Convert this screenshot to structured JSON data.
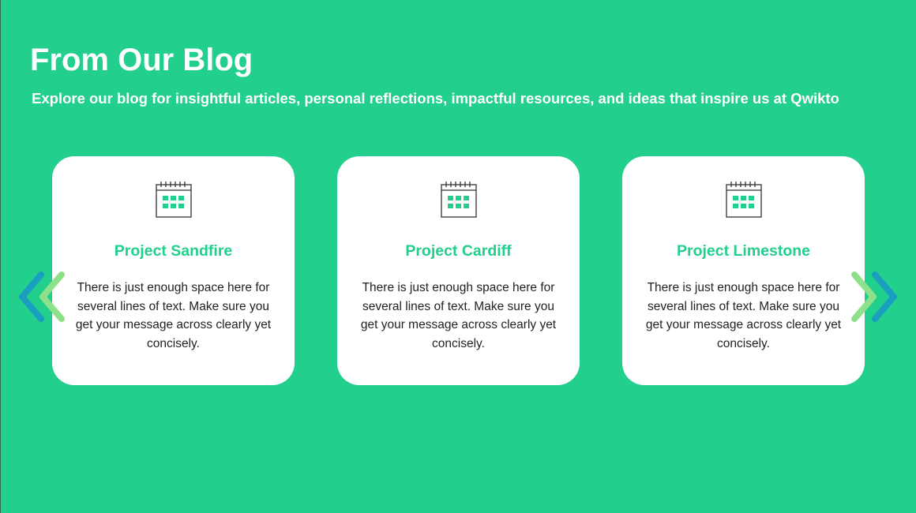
{
  "header": {
    "title": "From Our Blog",
    "subtitle": "Explore our blog for insightful articles, personal reflections, impactful resources, and ideas that inspire us at Qwikto"
  },
  "cards": [
    {
      "icon": "calendar-icon",
      "title": "Project Sandfire",
      "text": "There is just enough space here for several lines of text. Make sure you get your message across clearly yet concisely."
    },
    {
      "icon": "calendar-icon",
      "title": "Project Cardiff",
      "text": "There is just enough space here for several lines of text. Make sure you get your message across clearly yet concisely."
    },
    {
      "icon": "calendar-icon",
      "title": "Project Limestone",
      "text": "There is just enough space here for several lines of text. Make sure you get your message across clearly yet concisely."
    }
  ],
  "navigation": {
    "prev_icon": "chevron-left-icon",
    "next_icon": "chevron-right-icon"
  },
  "colors": {
    "background": "#22cf8c",
    "card": "#ffffff",
    "accent": "#22cf8c",
    "arrow_light": "#8ee08a",
    "arrow_dark": "#1a9fc0"
  }
}
